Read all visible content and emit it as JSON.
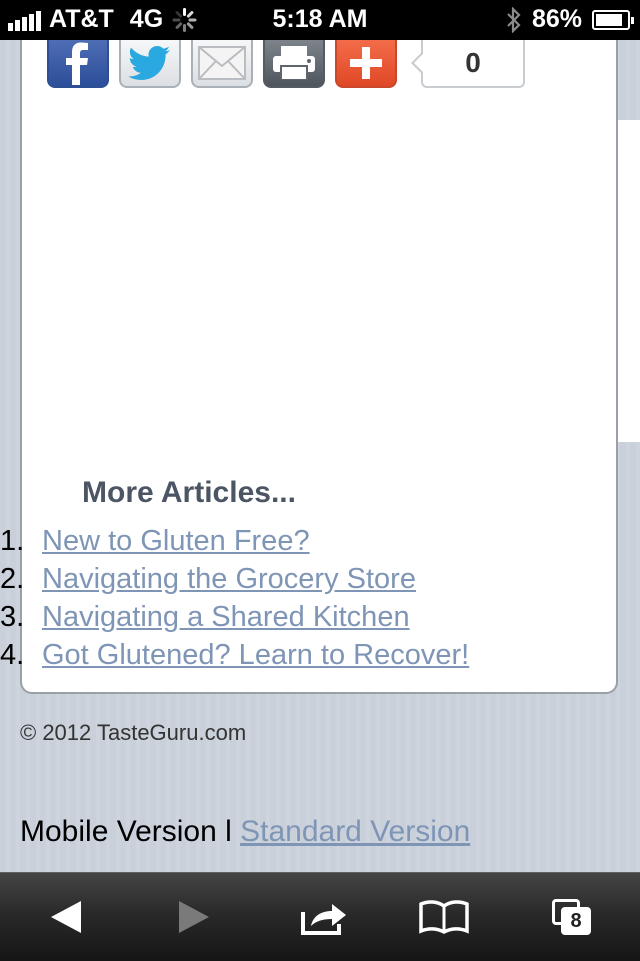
{
  "status_bar": {
    "carrier": "AT&T",
    "network": "4G",
    "time": "5:18 AM",
    "battery": "86%",
    "battery_level": 0.86
  },
  "share": {
    "count": "0",
    "icons": [
      "facebook-icon",
      "twitter-icon",
      "email-icon",
      "print-icon",
      "addthis-plus-icon"
    ]
  },
  "more_articles": {
    "title": "More Articles...",
    "items": [
      {
        "num": "1.",
        "label": "New to Gluten Free?"
      },
      {
        "num": "2.",
        "label": "Navigating the Grocery Store"
      },
      {
        "num": "3.",
        "label": "Navigating a Shared Kitchen"
      },
      {
        "num": "4.",
        "label": "Got Glutened? Learn to Recover!"
      }
    ]
  },
  "footer": {
    "copyright": "© 2012 TasteGuru.com",
    "mobile_version": "Mobile Version l ",
    "standard_version": "Standard Version"
  },
  "toolbar": {
    "tabs_count": "8",
    "icons": [
      "back-arrow-icon",
      "forward-arrow-icon",
      "share-icon",
      "bookmarks-icon",
      "tabs-icon"
    ]
  },
  "colors": {
    "link": "#7f95b6",
    "heading": "#4b5563",
    "page_bg": "#c9d0da"
  }
}
